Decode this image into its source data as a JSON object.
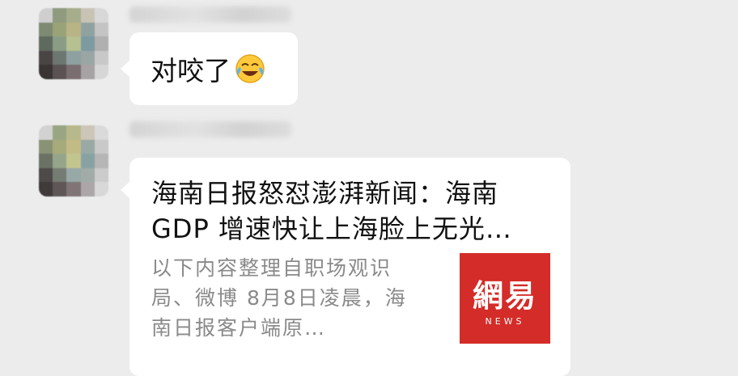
{
  "messages": [
    {
      "type": "text",
      "text": "对咬了",
      "emoji": "tears-of-joy-emoji"
    },
    {
      "type": "link-card",
      "title_line1": "海南日报怒怼澎湃新闻：海南",
      "title_line2": "GDP 增速快让上海脸上无光…",
      "desc_line1": "以下内容整理自职场观识",
      "desc_line2": "局、微博 8月8日凌晨，海",
      "desc_line3": "南日报客户端原…",
      "thumbnail": {
        "logo_text": "網易",
        "sub_text": "NEWS",
        "color": "#d42c28"
      }
    }
  ],
  "colors": {
    "chat_background": "#ececec",
    "bubble": "#ffffff",
    "text": "#111111",
    "description": "#8a8a8a"
  }
}
